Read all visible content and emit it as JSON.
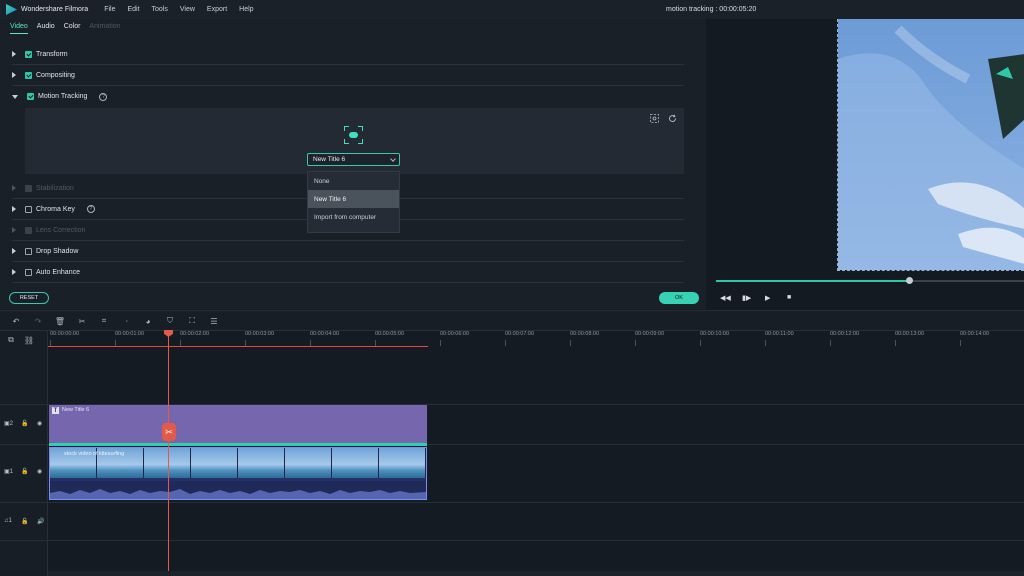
{
  "titlebar": {
    "app_name": "Wondershare Filmora",
    "menu": [
      "File",
      "Edit",
      "Tools",
      "View",
      "Export",
      "Help"
    ],
    "project": "motion tracking : 00:00:05:20"
  },
  "panel": {
    "tabs": [
      {
        "label": "Video",
        "state": "active"
      },
      {
        "label": "Audio",
        "state": "normal"
      },
      {
        "label": "Color",
        "state": "normal"
      },
      {
        "label": "Animation",
        "state": "disabled"
      }
    ],
    "sections": {
      "transform": "Transform",
      "compositing": "Compositing",
      "motion_tracking": "Motion Tracking",
      "stabilization": "Stabilization",
      "chroma_key": "Chroma Key",
      "lens_correction": "Lens Correction",
      "drop_shadow": "Drop Shadow",
      "auto_enhance": "Auto Enhance"
    },
    "dropdown": {
      "selected": "New Title 6",
      "options": [
        "None",
        "New Title 6",
        "Import from computer"
      ]
    },
    "reset_label": "RESET",
    "ok_label": "OK"
  },
  "timeline": {
    "ruler_ticks": [
      "00:00:00:00",
      "00:00:01:00",
      "00:00:02:00",
      "00:00:03:00",
      "00:00:04:00",
      "00:00:05:00",
      "00:00:06:00",
      "00:00:07:00",
      "00:00:08:00",
      "00:00:09:00",
      "00:00:10:00",
      "00:00:11:00",
      "00:00:12:00",
      "00:00:13:00",
      "00:00:14:00"
    ],
    "title_clip": "New Title 6",
    "video_clip": "stock video of kitesurfing"
  },
  "colors": {
    "accent": "#2ec7a8",
    "playhead": "#e45a4a",
    "title_clip": "#7566ae",
    "video_clip": "#25306a"
  }
}
